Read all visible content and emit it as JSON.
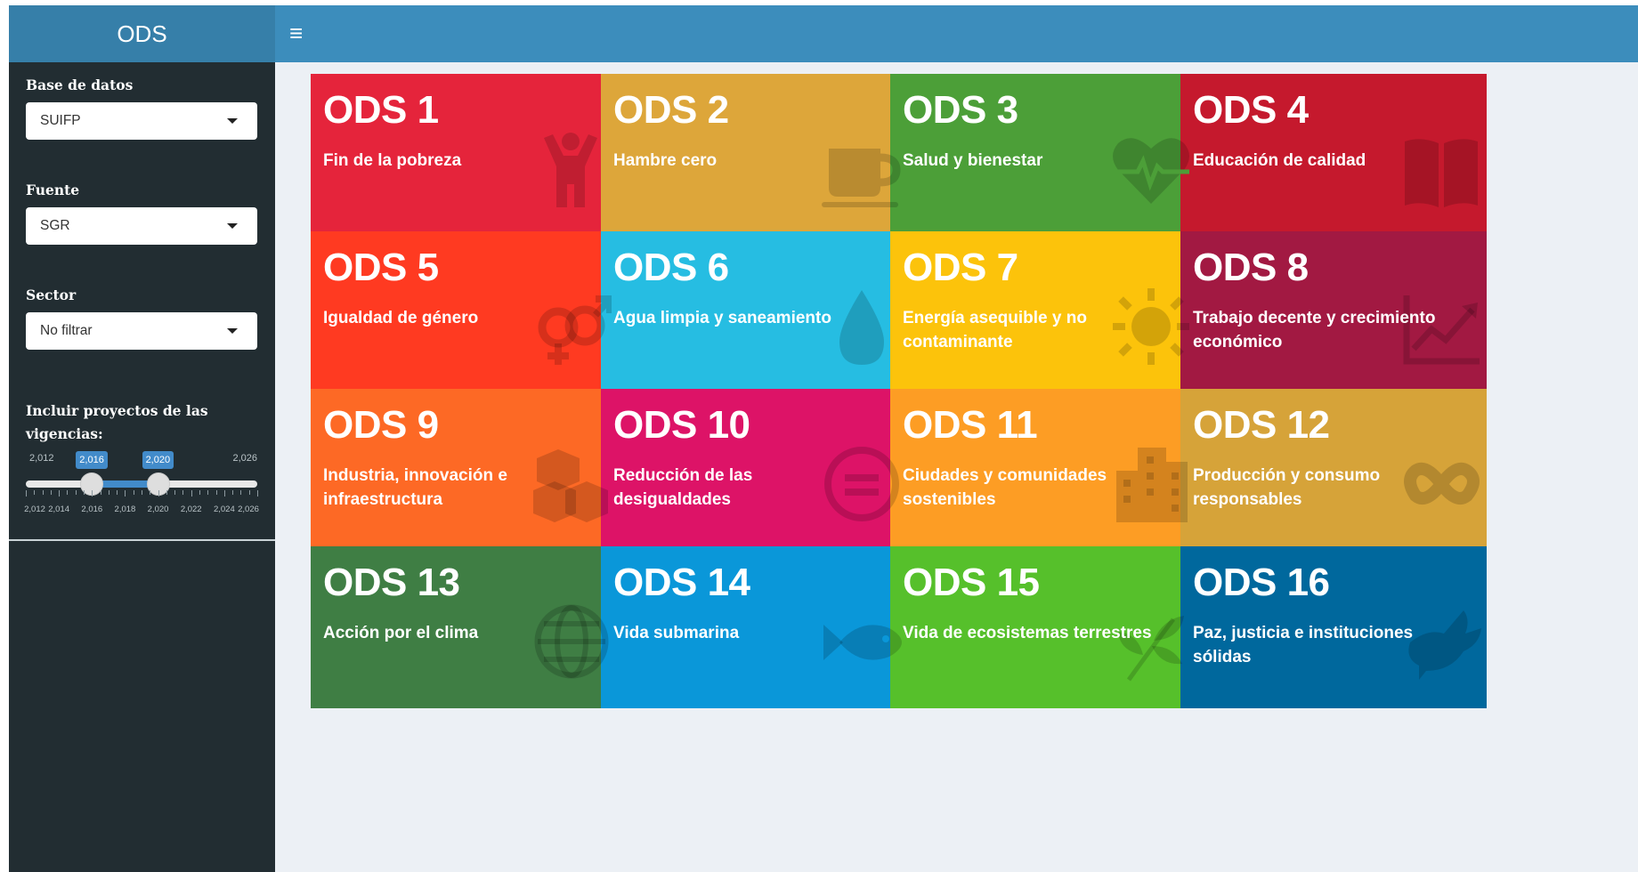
{
  "header": {
    "logo_text": "ODS",
    "menu_icon": "hamburger-icon"
  },
  "sidebar": {
    "base_datos": {
      "label": "Base de datos",
      "selected": "SUIFP"
    },
    "fuente": {
      "label": "Fuente",
      "selected": "SGR"
    },
    "sector": {
      "label": "Sector",
      "selected": "No filtrar"
    },
    "vigencias": {
      "label": "Incluir proyectos de las vigencias:",
      "min_label": "2,012",
      "max_label": "2,026",
      "from_label": "2,016",
      "to_label": "2,020",
      "min": 2012,
      "max": 2026,
      "from": 2016,
      "to": 2020,
      "grid_labels": [
        "2,012",
        "2,014",
        "2,016",
        "2,018",
        "2,020",
        "2,022",
        "2,024",
        "2,026"
      ]
    }
  },
  "tiles": [
    {
      "num": "ODS 1",
      "name": "Fin de la pobreza",
      "color": "#e5243b",
      "icon": "person-arms-up-icon"
    },
    {
      "num": "ODS 2",
      "name": "Hambre cero",
      "color": "#dda63a",
      "icon": "coffee-cup-icon"
    },
    {
      "num": "ODS 3",
      "name": "Salud y bienestar",
      "color": "#4c9f38",
      "icon": "heartbeat-icon"
    },
    {
      "num": "ODS 4",
      "name": "Educación de calidad",
      "color": "#c5192d",
      "icon": "open-book-icon"
    },
    {
      "num": "ODS 5",
      "name": "Igualdad de género",
      "color": "#ff3a21",
      "icon": "gender-symbols-icon"
    },
    {
      "num": "ODS 6",
      "name": "Agua limpia y saneamiento",
      "color": "#26bde2",
      "icon": "water-drop-icon"
    },
    {
      "num": "ODS 7",
      "name": "Energía asequible y no contaminante",
      "color": "#fcc30b",
      "icon": "sun-icon"
    },
    {
      "num": "ODS 8",
      "name": "Trabajo decente y crecimiento económico",
      "color": "#a21942",
      "icon": "line-chart-icon"
    },
    {
      "num": "ODS 9",
      "name": "Industria, innovación e infraestructura",
      "color": "#fd6925",
      "icon": "cubes-icon"
    },
    {
      "num": "ODS 10",
      "name": "Reducción de las desigualdades",
      "color": "#dd1367",
      "icon": "equals-circle-icon"
    },
    {
      "num": "ODS 11",
      "name": "Ciudades y comunidades sostenibles",
      "color": "#fd9d24",
      "icon": "building-icon"
    },
    {
      "num": "ODS 12",
      "name": "Producción y consumo responsables",
      "color": "#d6a339",
      "icon": "infinity-icon"
    },
    {
      "num": "ODS 13",
      "name": "Acción por el clima",
      "color": "#3f7e44",
      "icon": "globe-icon"
    },
    {
      "num": "ODS 14",
      "name": "Vida submarina",
      "color": "#0a97d9",
      "icon": "fish-icon"
    },
    {
      "num": "ODS 15",
      "name": "Vida de ecosistemas terrestres",
      "color": "#56c02b",
      "icon": "leaf-icon"
    },
    {
      "num": "ODS 16",
      "name": "Paz, justicia e instituciones sólidas",
      "color": "#00689d",
      "icon": "dove-icon"
    }
  ]
}
